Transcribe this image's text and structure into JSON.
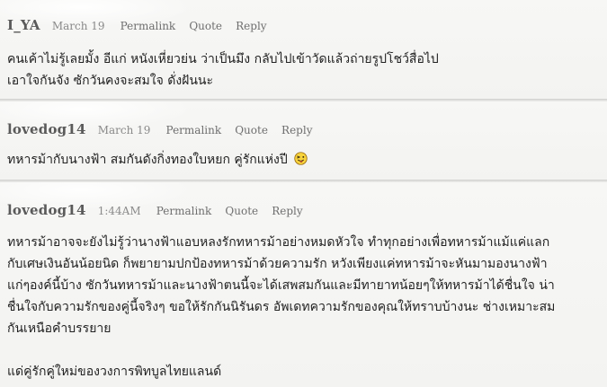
{
  "comments": [
    {
      "author": "I_YA",
      "date": "March 19",
      "permalink_label": "Permalink",
      "quote_label": "Quote",
      "reply_label": "Reply",
      "lines": [
        "คนเค้าไม่รู้เลยมั้ง อีแก่ หนังเหี่ยวย่น ว่าเป็นมึง กลับไปเข้าวัดแล้วถ่ายรูปโชว์สื่อไป",
        "เอาใจกันจัง ซักวันคงจะสมใจ ดั่งฝันนะ"
      ]
    },
    {
      "author": "lovedog14",
      "date": "March 19",
      "permalink_label": "Permalink",
      "quote_label": "Quote",
      "reply_label": "Reply",
      "text": "ทหารม้ากับนางฟ้า สมกันดังกิ่งทองใบหยก คู่รักแห่งปี",
      "emoji_icon": "tongue-out-smiley-icon"
    },
    {
      "author": "lovedog14",
      "date": "1:44AM",
      "permalink_label": "Permalink",
      "quote_label": "Quote",
      "reply_label": "Reply",
      "paragraph_lines": [
        "ทหารม้าอาจจะยังไม่รู้ว่านางฟ้าแอบหลงรักทหารม้าอย่างหมดหัวใจ ทำทุกอย่างเพื่อทหารม้าแม้แค่แลก",
        "กับเศษเงินอันน้อยนิด ก็พยายามปกป้องทหารม้าด้วยความรัก หวังเพียงแค่ทหารม้าจะหันมามองนางฟ้า",
        "แก่ๆองค์นี้บ้าง ซักวันทหารม้าและนางฟ้าตนนี้จะได้เสพสมกันและมีทายาทน้อยๆให้ทหารม้าได้ชื่นใจ น่า",
        "ชื่นใจกับความรักของคู่นี้จริงๆ ขอให้รักกันนิรันดร อัพเดทความรักของคุณให้ทราบบ้างนะ ช่างเหมาะสม",
        "กันเหนือคำบรรยาย"
      ],
      "signoff": "แด่คู่รักคู่ใหม่ของวงการพิทบูลไทยแลนด์"
    }
  ]
}
